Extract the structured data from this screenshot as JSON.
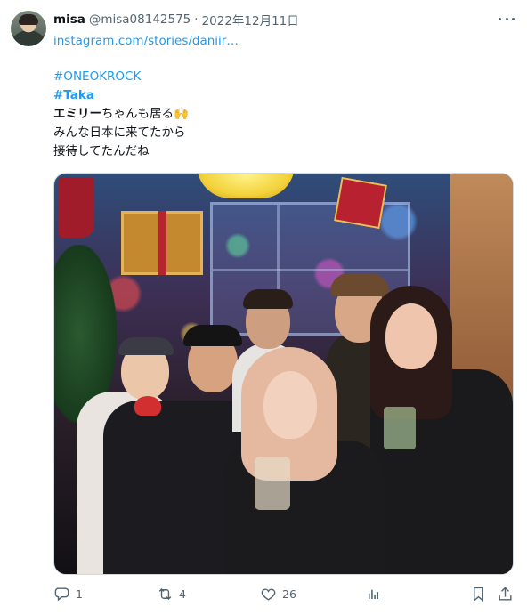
{
  "author": {
    "display_name": "misa",
    "handle": "@misa08142575",
    "separator": "·",
    "date": "2022年12月11日"
  },
  "tweet": {
    "link": "instagram.com/stories/daniir…",
    "hashtags": [
      "#ONEOKROCK",
      "#Taka"
    ],
    "line3_bold": "エミリー",
    "line3_rest": "ちゃんも居る🙌",
    "line4": "みんな日本に来てたから",
    "line5": "接待してたんだね"
  },
  "media": {
    "icon": "photo"
  },
  "actions": {
    "reply_count": "1",
    "retweet_count": "4",
    "like_count": "26"
  },
  "colors": {
    "link": "#1d9bf0",
    "secondary_text": "#536471",
    "primary_text": "#0f1419"
  }
}
